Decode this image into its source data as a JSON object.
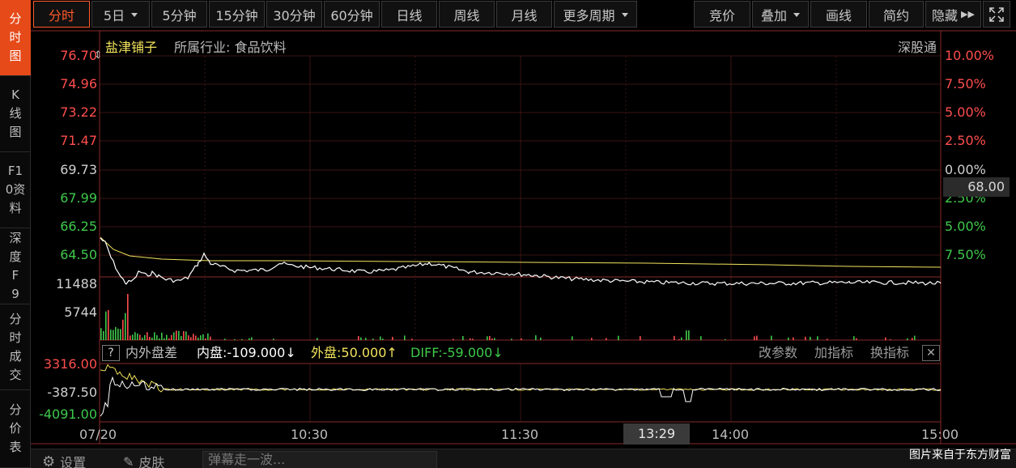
{
  "leftnav": [
    {
      "label": "分时图",
      "active": true
    },
    {
      "label": "K线图",
      "active": false
    },
    {
      "label": "F10资料",
      "active": false
    },
    {
      "label": "深度F9",
      "active": false
    },
    {
      "label": "分时成交",
      "active": false
    },
    {
      "label": "分价表",
      "active": false
    }
  ],
  "toolbar": {
    "periods": [
      "分时",
      "5日",
      "5分钟",
      "15分钟",
      "30分钟",
      "60分钟",
      "日线",
      "周线",
      "月线",
      "更多周期"
    ],
    "right": [
      "竞价",
      "叠加",
      "画线",
      "简约",
      "隐藏"
    ]
  },
  "stock": {
    "name": "盐津铺子",
    "industry": "所属行业: 食品饮料",
    "connect": "深股通"
  },
  "price_axis": [
    "76.70",
    "74.96",
    "73.22",
    "71.47",
    "69.73",
    "67.99",
    "66.25",
    "64.50"
  ],
  "pct_axis": [
    "10.00%",
    "7.50%",
    "5.00%",
    "2.50%",
    "0.00%",
    "2.50%",
    "5.00%",
    "7.50%"
  ],
  "current_price": "68.00",
  "volume_axis": [
    "11488",
    "5744"
  ],
  "indicator": {
    "q": "?",
    "name": "内外盘差",
    "inner": "内盘:-109.000↓",
    "outer": "外盘:50.000↑",
    "diff": "DIFF:-59.000↓",
    "buttons": [
      "改参数",
      "加指标",
      "换指标"
    ],
    "axis": [
      "3316.00",
      "-387.50",
      "-4091.00"
    ]
  },
  "time_axis": [
    "07/20",
    "10:30",
    "11:30",
    "14:00",
    "15:00"
  ],
  "hover_time": "13:29",
  "bottom": {
    "settings": "设置",
    "skin": "皮肤",
    "danmaku": "弹幕走一波...",
    "watermark": "图片来自于东方财富"
  },
  "colors": {
    "price_line": "#ffffff",
    "avg_line": "#f2e35c",
    "up": "#ff4d4d",
    "down": "#3ec94b",
    "accent": "#e64a19"
  }
}
